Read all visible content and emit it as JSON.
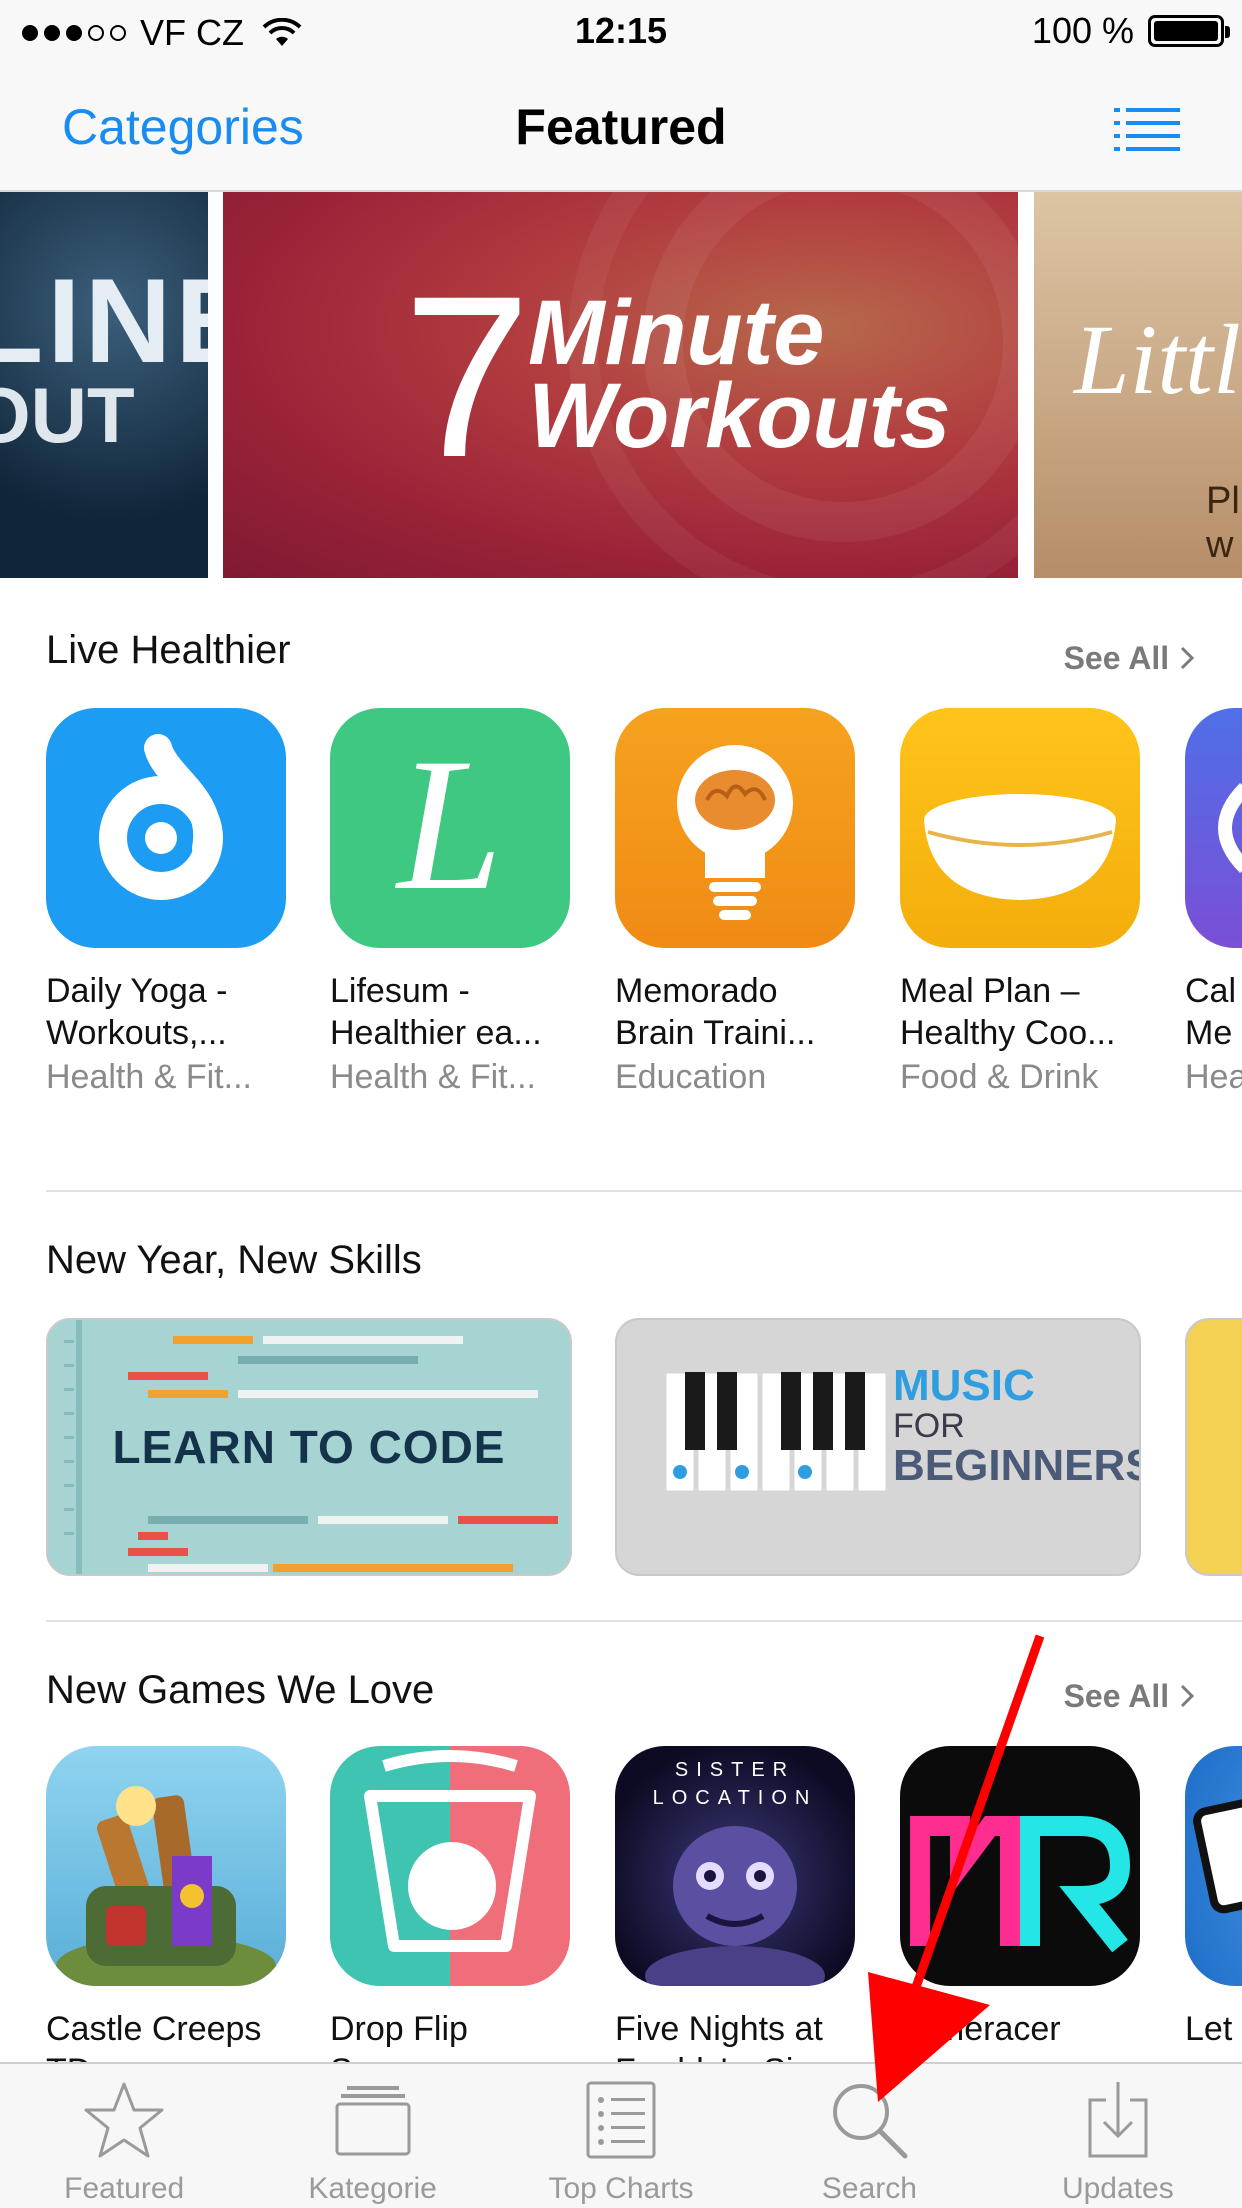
{
  "status_bar": {
    "carrier": "VF CZ",
    "time": "12:15",
    "battery": "100 %"
  },
  "nav": {
    "left_label": "Categories",
    "title": "Featured",
    "list_icon": "list-icon"
  },
  "banners": {
    "left_line1": "LINE",
    "left_line2": "OUT",
    "main_number": "7",
    "main_line1": "Minute",
    "main_line2": "Workouts",
    "right_line1": "Littl",
    "right_line2": "Pl",
    "right_line3": "w"
  },
  "live_healthier": {
    "title": "Live Healthier",
    "see_all": "See All",
    "apps": [
      {
        "name1": "Daily Yoga -",
        "name2": "Workouts,...",
        "category": "Health & Fit..."
      },
      {
        "name1": "Lifesum -",
        "name2": "Healthier ea...",
        "category": "Health & Fit..."
      },
      {
        "name1": "Memorado",
        "name2": "Brain Traini...",
        "category": "Education"
      },
      {
        "name1": "Meal Plan –",
        "name2": "Healthy Coo...",
        "category": "Food & Drink"
      },
      {
        "name1": "Cal",
        "name2": "Me",
        "category": "Hea"
      }
    ]
  },
  "new_year": {
    "title": "New Year, New Skills",
    "cards": [
      {
        "label": "LEARN TO CODE"
      },
      {
        "label1": "MUSIC",
        "label2": "FOR",
        "label3": "BEGINNERS"
      }
    ]
  },
  "new_games": {
    "title": "New Games We Love",
    "see_all": "See All",
    "apps": [
      {
        "name1": "Castle Creeps",
        "name2": "TD"
      },
      {
        "name1": "Drop Flip",
        "name2": "S"
      },
      {
        "name1": "Five Nights at",
        "name2": "Freddy's: Si"
      },
      {
        "name1": "esmeracer",
        "name2": ""
      },
      {
        "name1": "Let",
        "name2": ""
      }
    ],
    "five_nights_overlay": "SISTER LOCATION"
  },
  "tabs": [
    {
      "label": "Featured",
      "icon": "star-icon"
    },
    {
      "label": "Kategorie",
      "icon": "stack-icon"
    },
    {
      "label": "Top Charts",
      "icon": "list-icon"
    },
    {
      "label": "Search",
      "icon": "search-icon"
    },
    {
      "label": "Updates",
      "icon": "download-icon"
    }
  ],
  "colors": {
    "accent": "#1a8cf0",
    "annotation_arrow": "#ff0000"
  }
}
